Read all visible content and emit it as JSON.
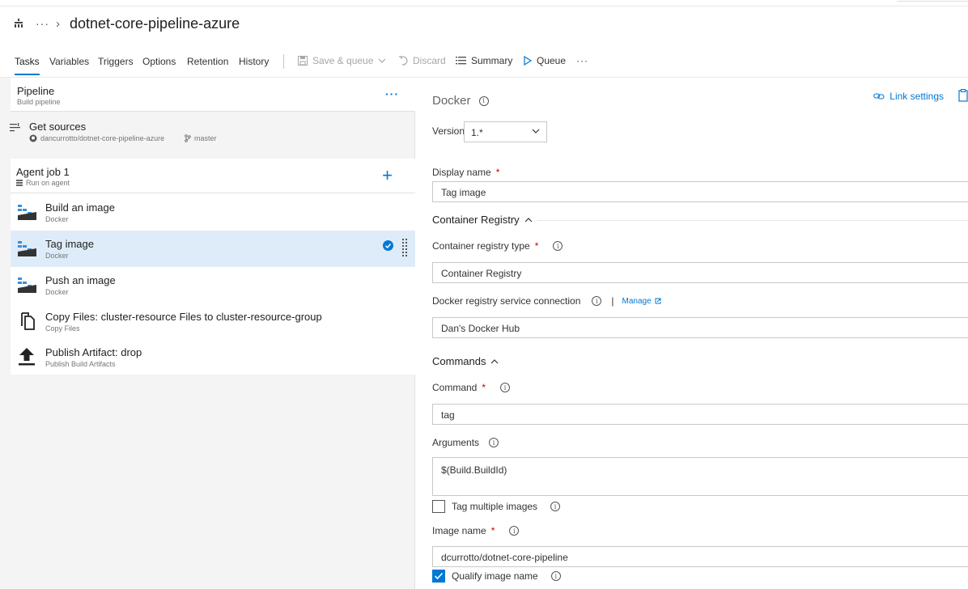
{
  "header": {
    "breadcrumb_dots": "···",
    "title": "dotnet-core-pipeline-azure"
  },
  "tabs": [
    {
      "label": "Tasks"
    },
    {
      "label": "Variables"
    },
    {
      "label": "Triggers"
    },
    {
      "label": "Options"
    },
    {
      "label": "Retention"
    },
    {
      "label": "History"
    }
  ],
  "toolbar": {
    "save_queue": "Save & queue",
    "discard": "Discard",
    "summary": "Summary",
    "queue": "Queue",
    "more": "···"
  },
  "pipeline": {
    "title": "Pipeline",
    "subtitle": "Build pipeline",
    "more": "···"
  },
  "get_sources": {
    "title": "Get sources",
    "repo": "dancurrotto/dotnet-core-pipeline-azure",
    "branch": "master"
  },
  "agent_job": {
    "title": "Agent job 1",
    "subtitle": "Run on agent",
    "add": "+"
  },
  "tasks": [
    {
      "title": "Build an image",
      "subtitle": "Docker",
      "icon": "docker-icon"
    },
    {
      "title": "Tag image",
      "subtitle": "Docker",
      "icon": "docker-icon",
      "selected": true
    },
    {
      "title": "Push an image",
      "subtitle": "Docker",
      "icon": "docker-icon"
    },
    {
      "title": "Copy Files: cluster-resource Files to cluster-resource-group",
      "subtitle": "Copy Files",
      "icon": "copy-files-icon"
    },
    {
      "title": "Publish Artifact: drop",
      "subtitle": "Publish Build Artifacts",
      "icon": "publish-artifact-icon"
    }
  ],
  "details": {
    "title": "Docker",
    "link_settings": "Link settings",
    "version_label": "Version",
    "version_value": "1.*",
    "display_name_label": "Display name",
    "display_name_value": "Tag image",
    "required_mark": "*",
    "container_registry_section": "Container Registry",
    "registry_type_label": "Container registry type",
    "registry_type_value": "Container Registry",
    "service_connection_label": "Docker registry service connection",
    "manage": "Manage",
    "divider": "|",
    "service_connection_value": "Dan's Docker Hub",
    "commands_section": "Commands",
    "command_label": "Command",
    "command_value": "tag",
    "arguments_label": "Arguments",
    "arguments_value": "$(Build.BuildId)",
    "tag_multiple_label": "Tag multiple images",
    "tag_multiple_checked": false,
    "image_name_label": "Image name",
    "image_name_value": "dcurrotto/dotnet-core-pipeline",
    "qualify_label": "Qualify image name",
    "qualify_checked": true
  },
  "colors": {
    "accent": "#0078d4",
    "selected_row": "#deecf9",
    "panel_bg": "#f4f4f4"
  }
}
